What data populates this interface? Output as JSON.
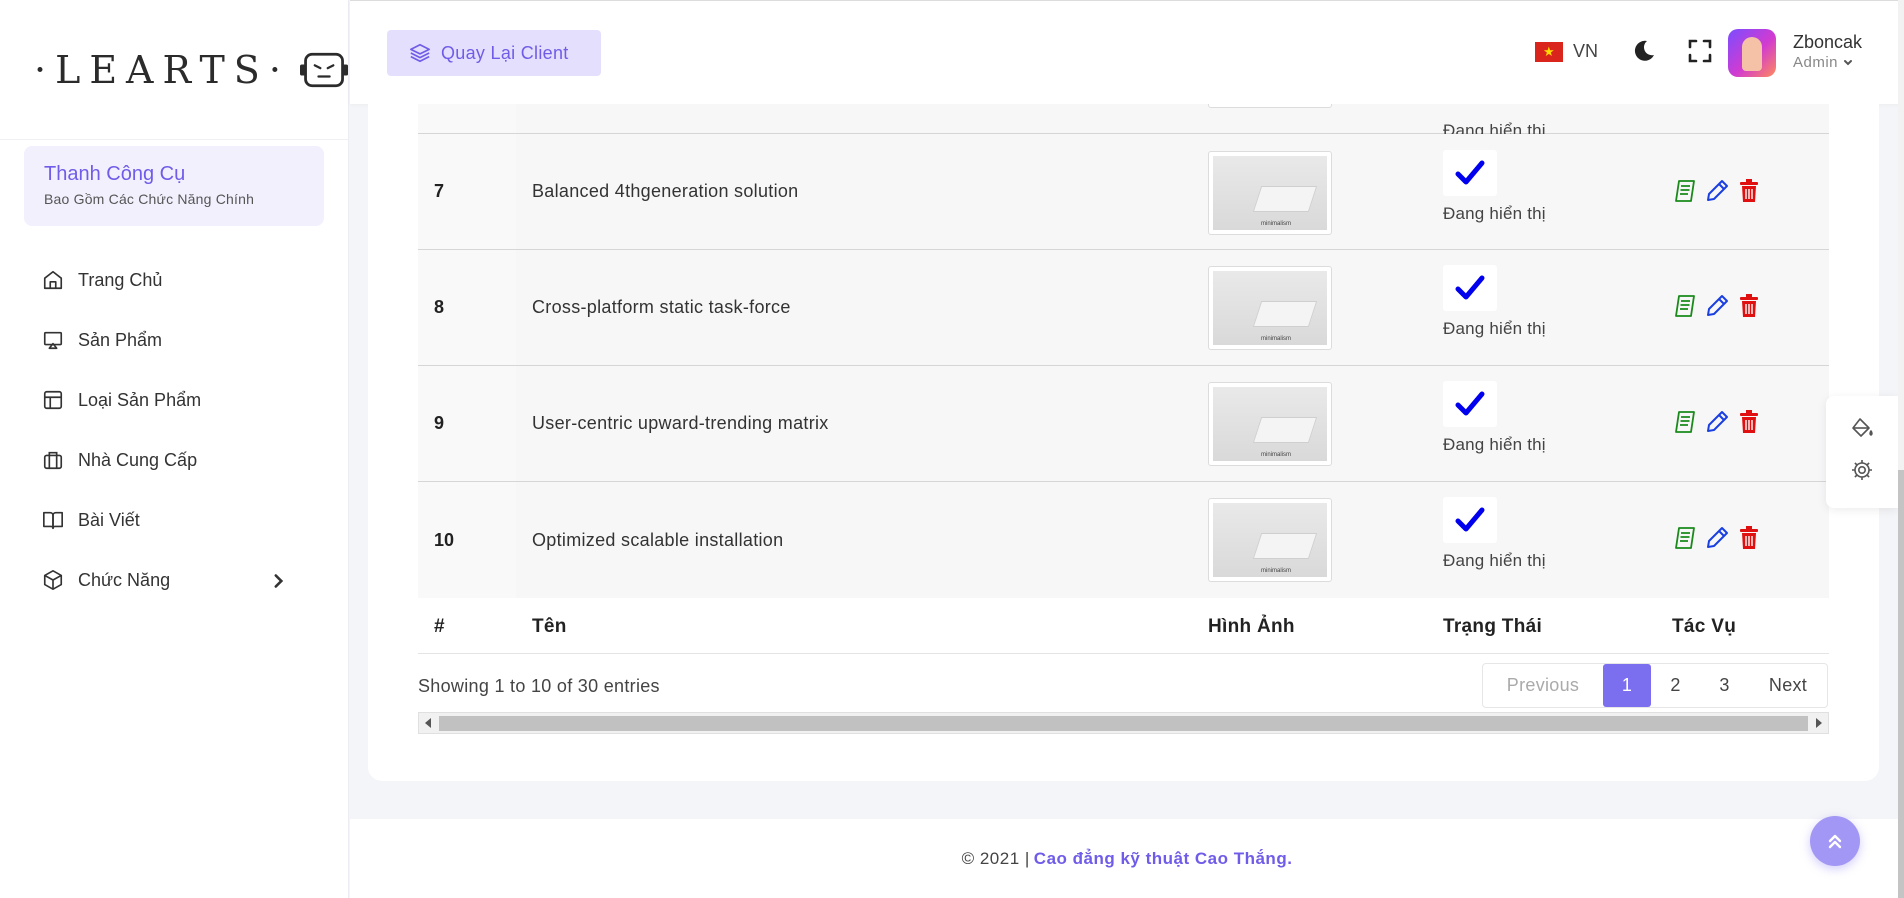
{
  "sidebar": {
    "logo": "·LEARTS·",
    "toolbar_title": "Thanh Công Cụ",
    "toolbar_subtitle": "Bao Gồm Các Chức Năng Chính",
    "items": [
      {
        "label": "Trang Chủ",
        "icon": "home-icon"
      },
      {
        "label": "Sản Phẩm",
        "icon": "display-icon"
      },
      {
        "label": "Loại Sản Phẩm",
        "icon": "layout-icon"
      },
      {
        "label": "Nhà Cung Cấp",
        "icon": "briefcase-icon"
      },
      {
        "label": "Bài Viết",
        "icon": "book-icon"
      },
      {
        "label": "Chức Năng",
        "icon": "box-icon"
      }
    ]
  },
  "header": {
    "back_button": "Quay Lại Client",
    "language": "VN",
    "user_name": "Zboncak",
    "user_role": "Admin"
  },
  "table": {
    "columns": [
      "#",
      "Tên",
      "Hình Ảnh",
      "Trạng Thái",
      "Tác Vụ"
    ],
    "partial_row_status": "Đang hiển thị",
    "image_caption": "minimalism",
    "rows": [
      {
        "id": "7",
        "name": "Balanced 4thgeneration solution",
        "status": "Đang hiển thị"
      },
      {
        "id": "8",
        "name": "Cross-platform static task-force",
        "status": "Đang hiển thị"
      },
      {
        "id": "9",
        "name": "User-centric upward-trending matrix",
        "status": "Đang hiển thị"
      },
      {
        "id": "10",
        "name": "Optimized scalable installation",
        "status": "Đang hiển thị"
      }
    ],
    "info": "Showing 1 to 10 of 30 entries"
  },
  "pagination": {
    "previous": "Previous",
    "pages": [
      "1",
      "2",
      "3"
    ],
    "active": "1",
    "next": "Next"
  },
  "footer": {
    "text": "© 2021 |",
    "link": "Cao đẳng kỹ thuật Cao Thắng."
  },
  "colors": {
    "accent": "#7b6ff0",
    "check": "#0000ee",
    "view": "#1a8a1a",
    "edit": "#1a3fe0",
    "delete": "#e01010"
  }
}
